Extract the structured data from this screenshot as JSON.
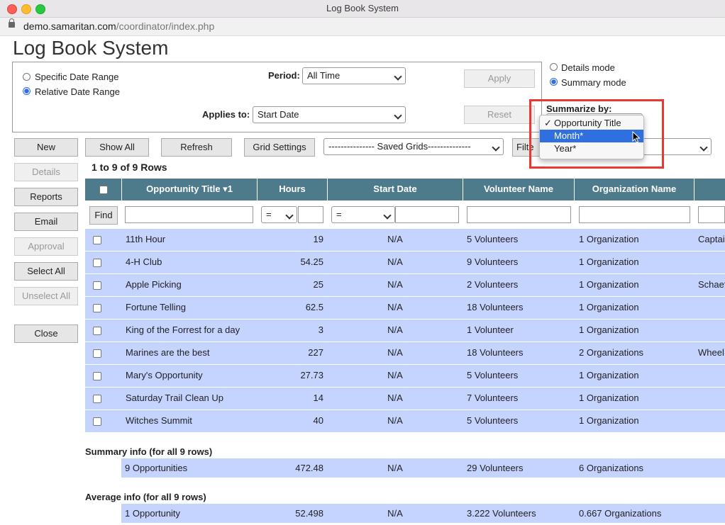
{
  "window": {
    "title": "Log Book System"
  },
  "browser": {
    "url_host": "demo.samaritan.com",
    "url_path": "/coordinator/index.php"
  },
  "page": {
    "heading": "Log Book System"
  },
  "filters": {
    "specific_date_range": "Specific Date Range",
    "relative_date_range": "Relative Date Range",
    "period_label": "Period:",
    "period_value": "All Time",
    "applies_to_label": "Applies to:",
    "applies_to_value": "Start Date",
    "apply": "Apply",
    "reset": "Reset"
  },
  "mode": {
    "details": "Details mode",
    "summary": "Summary mode",
    "summarize_by_label": "Summarize by:"
  },
  "summarize_dropdown": {
    "check": "✓",
    "options": [
      "Opportunity Title",
      "Month*",
      "Year*"
    ]
  },
  "toolbar": {
    "show_all": "Show All",
    "refresh": "Refresh",
    "grid_settings": "Grid Settings",
    "saved_grids": "--------------- Saved Grids--------------",
    "filter_partial": "Filte"
  },
  "side_buttons": {
    "new": "New",
    "details": "Details",
    "reports": "Reports",
    "email": "Email",
    "approval": "Approval",
    "select_all": "Select All",
    "unselect_all": "Unselect All",
    "close": "Close"
  },
  "grid": {
    "row_count": "1 to 9 of 9 Rows",
    "columns": [
      "Opportunity Title ▾1",
      "Hours",
      "Start Date",
      "Volunteer Name",
      "Organization Name"
    ],
    "find": "Find",
    "op_eq": "=",
    "rows": [
      {
        "title": "11th Hour",
        "hours": "19",
        "start": "N/A",
        "volunteers": "5 Volunteers",
        "orgs": "1 Organization",
        "extra": "Captai"
      },
      {
        "title": "4-H Club",
        "hours": "54.25",
        "start": "N/A",
        "volunteers": "9 Volunteers",
        "orgs": "1 Organization",
        "extra": ""
      },
      {
        "title": "Apple Picking",
        "hours": "25",
        "start": "N/A",
        "volunteers": "2 Volunteers",
        "orgs": "1 Organization",
        "extra": "Schaef"
      },
      {
        "title": "Fortune Telling",
        "hours": "62.5",
        "start": "N/A",
        "volunteers": "18 Volunteers",
        "orgs": "1 Organization",
        "extra": ""
      },
      {
        "title": "King of the Forrest for a day",
        "hours": "3",
        "start": "N/A",
        "volunteers": "1 Volunteer",
        "orgs": "1 Organization",
        "extra": ""
      },
      {
        "title": "Marines are the best",
        "hours": "227",
        "start": "N/A",
        "volunteers": "18 Volunteers",
        "orgs": "2 Organizations",
        "extra": "Wheel"
      },
      {
        "title": "Mary's Opportunity",
        "hours": "27.73",
        "start": "N/A",
        "volunteers": "5 Volunteers",
        "orgs": "1 Organization",
        "extra": ""
      },
      {
        "title": "Saturday Trail Clean Up",
        "hours": "14",
        "start": "N/A",
        "volunteers": "7 Volunteers",
        "orgs": "1 Organization",
        "extra": ""
      },
      {
        "title": "Witches Summit",
        "hours": "40",
        "start": "N/A",
        "volunteers": "5 Volunteers",
        "orgs": "1 Organization",
        "extra": ""
      }
    ]
  },
  "summary": {
    "title": "Summary info (for all 9 rows)",
    "title_col": "9 Opportunities",
    "hours": "472.48",
    "start": "N/A",
    "volunteers": "29 Volunteers",
    "orgs": "6 Organizations"
  },
  "average": {
    "title": "Average info (for all 9 rows)",
    "title_col": "1 Opportunity",
    "hours": "52.498",
    "start": "N/A",
    "volunteers": "3.222 Volunteers",
    "orgs": "0.667 Organizations"
  }
}
